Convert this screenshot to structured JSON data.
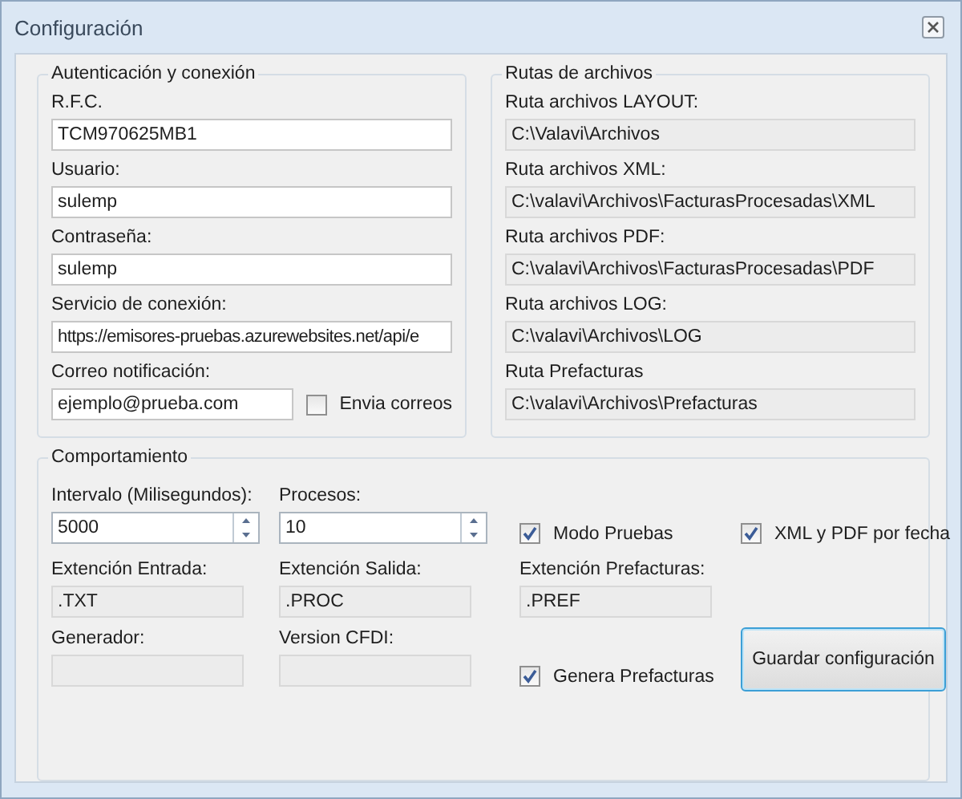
{
  "window": {
    "title": "Configuración"
  },
  "authentication": {
    "title": "Autenticación y conexión",
    "fields": [
      {
        "label": "R.F.C.",
        "value": "TCM970625MB1"
      },
      {
        "label": "Usuario:",
        "value": "sulemp"
      },
      {
        "label": "Contraseña:",
        "value": "sulemp"
      },
      {
        "label": "Servicio de conexión:",
        "value": "https://emisores-pruebas.azurewebsites.net/api/e"
      }
    ],
    "email": {
      "label": "Correo notificación:",
      "value": "ejemplo@prueba.com"
    },
    "send_mail": {
      "label": "Envia correos",
      "checked": false
    }
  },
  "paths": {
    "title": "Rutas de archivos",
    "fields": [
      {
        "label": "Ruta archivos LAYOUT:",
        "value": "C:\\Valavi\\Archivos"
      },
      {
        "label": "Ruta archivos XML:",
        "value": "C:\\valavi\\Archivos\\FacturasProcesadas\\XML"
      },
      {
        "label": "Ruta archivos PDF:",
        "value": "C:\\valavi\\Archivos\\FacturasProcesadas\\PDF"
      },
      {
        "label": "Ruta archivos LOG:",
        "value": "C:\\valavi\\Archivos\\LOG"
      },
      {
        "label": "Ruta Prefacturas",
        "value": "C:\\valavi\\Archivos\\Prefacturas"
      }
    ]
  },
  "behavior": {
    "title": "Comportamiento",
    "interval": {
      "label": "Intervalo (Milisegundos):",
      "value": "5000"
    },
    "processes": {
      "label": "Procesos:",
      "value": "10"
    },
    "test_mode": {
      "label": "Modo Pruebas",
      "checked": true
    },
    "xml_pdf_by_date": {
      "label": "XML y PDF por fecha",
      "checked": true
    },
    "ext_in": {
      "label": "Extención Entrada:",
      "value": ".TXT"
    },
    "ext_out": {
      "label": "Extención Salida:",
      "value": ".PROC"
    },
    "ext_pref": {
      "label": "Extención Prefacturas:",
      "value": ".PREF"
    },
    "generator": {
      "label": "Generador:"
    },
    "version_cfdi": {
      "label": "Version CFDI:"
    },
    "generate_prefacturas": {
      "label": "Genera Prefacturas",
      "checked": true
    },
    "save_button": "Guardar configuración"
  }
}
